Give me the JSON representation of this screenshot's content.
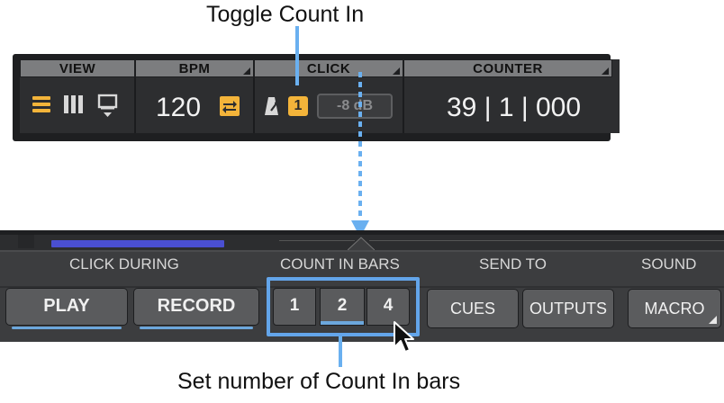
{
  "callouts": {
    "top": "Toggle Count In",
    "bottom": "Set number of Count In bars"
  },
  "toolbar": {
    "view_label": "VIEW",
    "bpm_label": "BPM",
    "click_label": "CLICK",
    "counter_label": "COUNTER",
    "bpm_value": "120",
    "count_in_badge": "1",
    "click_volume": "-8 dB",
    "counter_value": "39 | 1 | 000"
  },
  "panel": {
    "click_during_label": "CLICK DURING",
    "count_in_bars_label": "COUNT IN BARS",
    "send_to_label": "SEND TO",
    "sound_label": "SOUND",
    "play_button": "PLAY",
    "record_button": "RECORD",
    "count_in_options": [
      "1",
      "2",
      "4"
    ],
    "count_in_selected": "2",
    "cues_button": "CUES",
    "outputs_button": "OUTPUTS",
    "macro_button": "MACRO"
  },
  "colors": {
    "accent_yellow": "#f3b43a",
    "highlight_blue": "#63a5ea",
    "progress_purple": "#4a4fd1"
  },
  "icons": [
    "hamburger-view-icon",
    "columns-view-icon",
    "monitor-view-icon",
    "cycle-icon",
    "metronome-icon",
    "mouse-pointer-icon"
  ]
}
